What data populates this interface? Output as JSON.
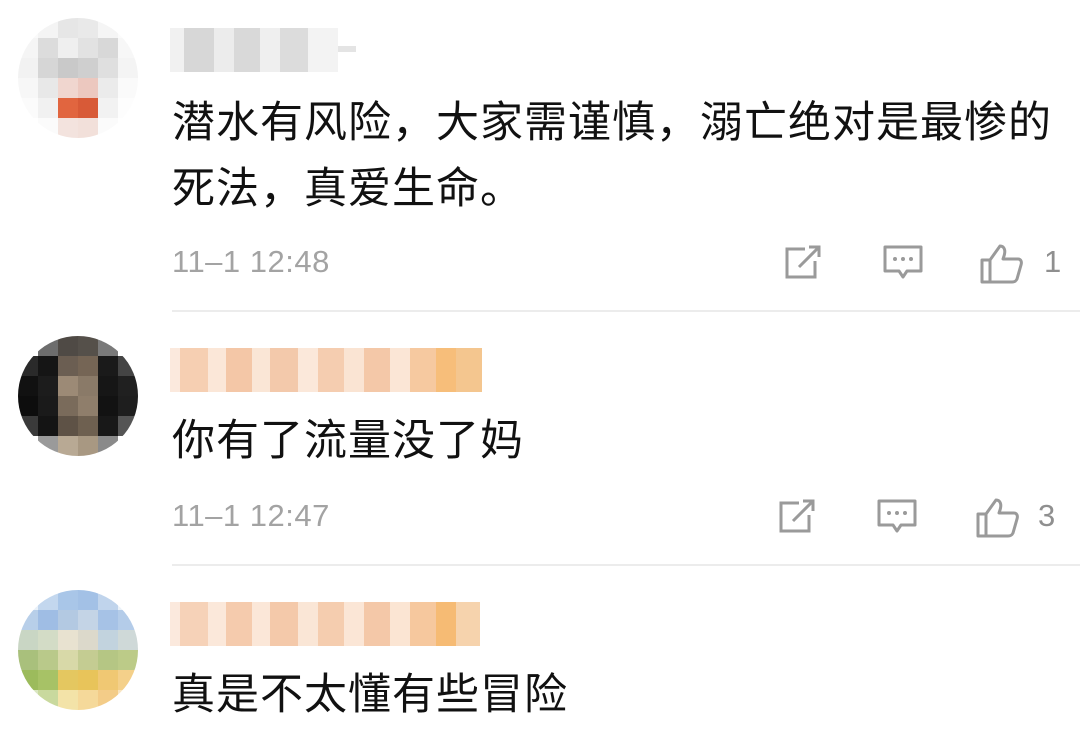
{
  "comments": [
    {
      "text": "潜水有风险，大家需谨慎，溺亡绝对是最惨的死法，真爱生命。",
      "time": "11–1 12:48",
      "likes": "1",
      "icons": [
        "share-icon",
        "reply-icon",
        "like-icon"
      ]
    },
    {
      "text": "你有了流量没了妈",
      "time": "11–1 12:47",
      "likes": "3",
      "icons": [
        "share-icon",
        "reply-icon",
        "like-icon"
      ]
    },
    {
      "text": "真是不太懂有些冒险"
    }
  ],
  "colors": {
    "text": "#111111",
    "meta": "#a3a3a3",
    "icon": "#9a9a9a",
    "divider": "#ececec"
  }
}
